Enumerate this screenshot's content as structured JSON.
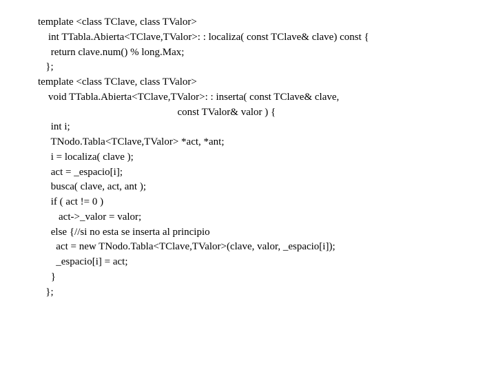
{
  "code": {
    "lines": [
      "template <class TClave, class TValor>",
      "    int TTabla.Abierta<TClave,TValor>: : localiza( const TClave& clave) const {",
      "     return clave.num() % long.Max;",
      "   };",
      "",
      "template <class TClave, class TValor>",
      "    void TTabla.Abierta<TClave,TValor>: : inserta( const TClave& clave,",
      "                                                      const TValor& valor ) {",
      "     int i;",
      "     TNodo.Tabla<TClave,TValor> *act, *ant;",
      "     i = localiza( clave );",
      "     act = _espacio[i];",
      "     busca( clave, act, ant );",
      "     if ( act != 0 )",
      "        act->_valor = valor;",
      "     else {//si no esta se inserta al principio",
      "       act = new TNodo.Tabla<TClave,TValor>(clave, valor, _espacio[i]);",
      "       _espacio[i] = act;",
      "     }",
      "   };"
    ]
  }
}
